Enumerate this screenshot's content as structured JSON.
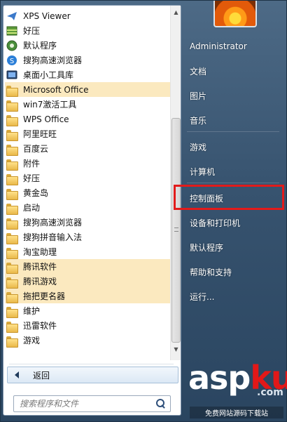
{
  "programs": [
    {
      "label": "XPS Viewer",
      "icon": "xps-viewer-icon",
      "highlight": false
    },
    {
      "label": "好压",
      "icon": "archive-icon",
      "highlight": false
    },
    {
      "label": "默认程序",
      "icon": "default-programs-icon",
      "highlight": false
    },
    {
      "label": "搜狗高速浏览器",
      "icon": "sogou-browser-icon",
      "highlight": false
    },
    {
      "label": "桌面小工具库",
      "icon": "gadgets-icon",
      "highlight": false
    },
    {
      "label": "Microsoft Office",
      "icon": "folder-icon",
      "highlight": true
    },
    {
      "label": "win7激活工具",
      "icon": "folder-icon",
      "highlight": false
    },
    {
      "label": "WPS Office",
      "icon": "folder-icon",
      "highlight": false
    },
    {
      "label": "阿里旺旺",
      "icon": "folder-icon",
      "highlight": false
    },
    {
      "label": "百度云",
      "icon": "folder-icon",
      "highlight": false
    },
    {
      "label": "附件",
      "icon": "folder-icon",
      "highlight": false
    },
    {
      "label": "好压",
      "icon": "folder-icon",
      "highlight": false
    },
    {
      "label": "黄金岛",
      "icon": "folder-icon",
      "highlight": false
    },
    {
      "label": "启动",
      "icon": "folder-icon",
      "highlight": false
    },
    {
      "label": "搜狗高速浏览器",
      "icon": "folder-icon",
      "highlight": false
    },
    {
      "label": "搜狗拼音输入法",
      "icon": "folder-icon",
      "highlight": false
    },
    {
      "label": "淘宝助理",
      "icon": "folder-icon",
      "highlight": false
    },
    {
      "label": "腾讯软件",
      "icon": "folder-icon",
      "highlight": true
    },
    {
      "label": "腾讯游戏",
      "icon": "folder-icon",
      "highlight": true
    },
    {
      "label": "拖把更名器",
      "icon": "folder-icon",
      "highlight": true
    },
    {
      "label": "维护",
      "icon": "folder-icon",
      "highlight": false
    },
    {
      "label": "迅雷软件",
      "icon": "folder-icon",
      "highlight": false
    },
    {
      "label": "游戏",
      "icon": "folder-icon",
      "highlight": false
    }
  ],
  "back_label": "返回",
  "search": {
    "placeholder": "搜索程序和文件"
  },
  "right_items": [
    {
      "label": "Administrator"
    },
    {
      "label": "文档"
    },
    {
      "label": "图片"
    },
    {
      "label": "音乐"
    },
    {
      "label": "游戏"
    },
    {
      "label": "计算机"
    },
    {
      "label": "控制面板"
    },
    {
      "label": "设备和打印机"
    },
    {
      "label": "默认程序"
    },
    {
      "label": "帮助和支持"
    },
    {
      "label": "运行..."
    }
  ],
  "highlighted_right_item": "控制面板",
  "colors": {
    "highlight_bg": "#fbe9bf",
    "annotation_box": "#e21b1b",
    "menu_bg": "#3f5873"
  },
  "watermark": {
    "logo_a": "asp",
    "logo_b": "ku",
    "dotcom": ".com",
    "subtitle": "免费网站源码下载站"
  }
}
